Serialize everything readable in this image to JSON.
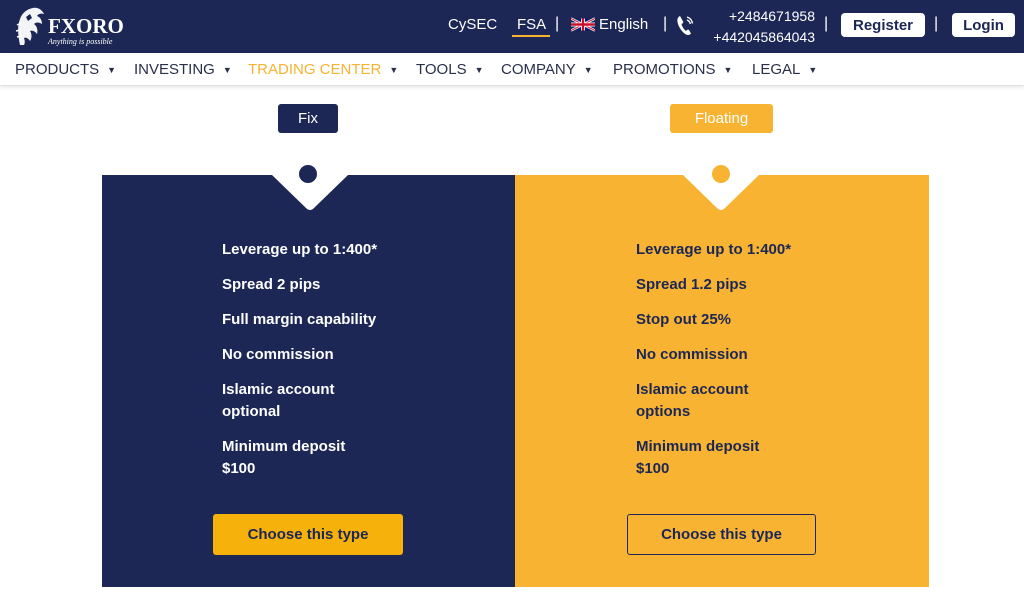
{
  "header": {
    "logo_text": "FXORO",
    "logo_tagline": "Anything is possible",
    "regulators": [
      "CySEC",
      "FSA"
    ],
    "active_regulator": "FSA",
    "language": "English",
    "phones": [
      "+2484671958",
      "+442045864043"
    ],
    "register_label": "Register",
    "login_label": "Login",
    "separator": "|"
  },
  "nav": {
    "items": [
      {
        "label": "PRODUCTS"
      },
      {
        "label": "INVESTING"
      },
      {
        "label": "TRADING CENTER",
        "active": true
      },
      {
        "label": "TOOLS"
      },
      {
        "label": "COMPANY"
      },
      {
        "label": "PROMOTIONS"
      },
      {
        "label": "LEGAL"
      }
    ]
  },
  "tabs": {
    "fix_label": "Fix",
    "floating_label": "Floating"
  },
  "plans": [
    {
      "name": "Fix",
      "features": [
        "Leverage up to 1:400*",
        "Spread 2 pips",
        "Full margin capability",
        "No commission",
        "Islamic account optional",
        "Minimum deposit $100"
      ],
      "button_label": "Choose this type"
    },
    {
      "name": "Floating",
      "features": [
        "Leverage up to 1:400*",
        "Spread 1.2 pips",
        "Stop out 25%",
        "No commission",
        "Islamic account options",
        "Minimum deposit $100"
      ],
      "button_label": "Choose this type"
    }
  ],
  "colors": {
    "navy": "#1c2755",
    "gold": "#f7b331",
    "button_gold": "#f7b10b",
    "white": "#ffffff"
  }
}
